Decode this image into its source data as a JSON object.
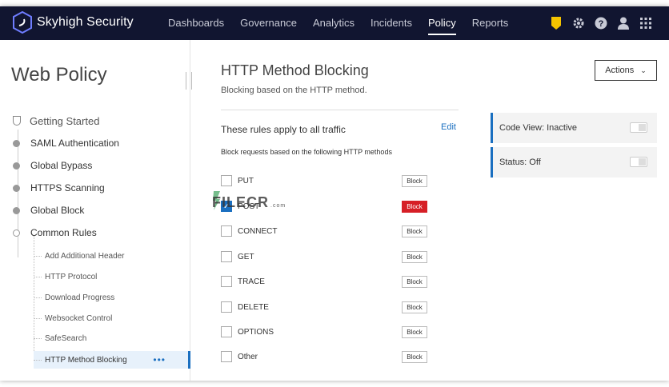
{
  "brand": {
    "name": "Skyhigh Security"
  },
  "nav": {
    "items": [
      {
        "label": "Dashboards",
        "active": false
      },
      {
        "label": "Governance",
        "active": false
      },
      {
        "label": "Analytics",
        "active": false
      },
      {
        "label": "Incidents",
        "active": false
      },
      {
        "label": "Policy",
        "active": true
      },
      {
        "label": "Reports",
        "active": false
      }
    ],
    "icons": [
      "shield-badge-icon",
      "gear-icon",
      "help-icon",
      "user-icon",
      "apps-grid-icon"
    ],
    "accent_color": "#f5c400"
  },
  "sidebar": {
    "title": "Web Policy",
    "items": [
      {
        "label": "Getting Started",
        "icon": "shield-outline-icon"
      },
      {
        "label": "SAML Authentication",
        "icon": "bullet"
      },
      {
        "label": "Global Bypass",
        "icon": "bullet"
      },
      {
        "label": "HTTPS Scanning",
        "icon": "bullet"
      },
      {
        "label": "Global Block",
        "icon": "bullet"
      },
      {
        "label": "Common Rules",
        "icon": "bullet-hollow"
      }
    ],
    "sub_items": [
      {
        "label": "Add Additional Header",
        "active": false
      },
      {
        "label": "HTTP Protocol",
        "active": false
      },
      {
        "label": "Download Progress",
        "active": false
      },
      {
        "label": "Websocket Control",
        "active": false
      },
      {
        "label": "SafeSearch",
        "active": false
      },
      {
        "label": "HTTP Method Blocking",
        "active": true
      }
    ],
    "more": "•••"
  },
  "main": {
    "title": "HTTP Method Blocking",
    "subtitle": "Blocking based on the HTTP method.",
    "actions_label": "Actions",
    "rules_heading": "These rules apply to all traffic",
    "edit_label": "Edit",
    "rules_desc": "Block requests based on the following HTTP methods",
    "block_label": "Block",
    "methods": [
      {
        "name": "PUT",
        "checked": false
      },
      {
        "name": "POST",
        "checked": true
      },
      {
        "name": "CONNECT",
        "checked": false
      },
      {
        "name": "GET",
        "checked": false
      },
      {
        "name": "TRACE",
        "checked": false
      },
      {
        "name": "DELETE",
        "checked": false
      },
      {
        "name": "OPTIONS",
        "checked": false
      },
      {
        "name": "Other",
        "checked": false
      }
    ],
    "cards": [
      {
        "label": "Code View: Inactive"
      },
      {
        "label": "Status: Off"
      }
    ]
  },
  "watermark": {
    "text": "FILECR",
    "suffix": ".com"
  },
  "colors": {
    "topbar": "#111530",
    "link": "#1a6fc0",
    "block_active": "#d61f26"
  }
}
